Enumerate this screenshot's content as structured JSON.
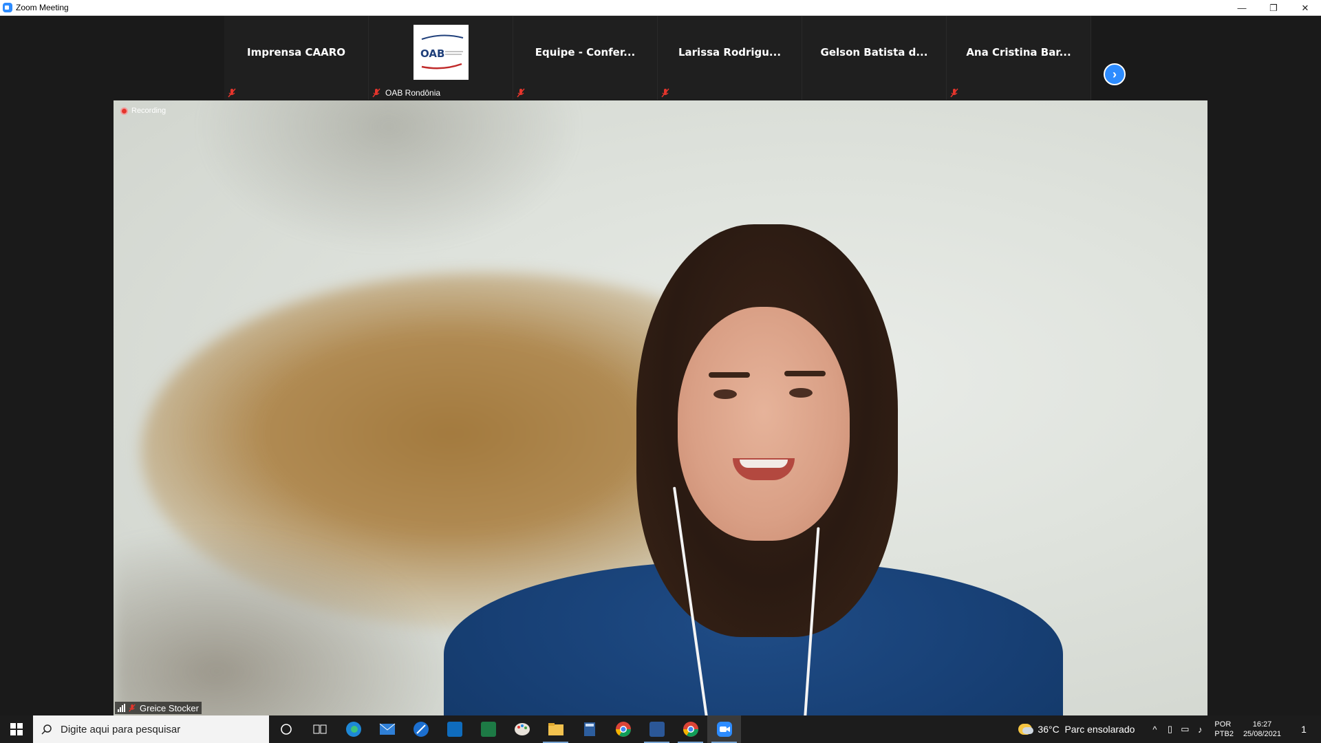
{
  "window": {
    "title": "Zoom Meeting",
    "minimize": "—",
    "restore": "❐",
    "close": "✕"
  },
  "thumbnails": [
    {
      "name": "Imprensa CAARO",
      "muted": true
    },
    {
      "label": "OAB Rondônia",
      "muted": true,
      "has_logo": true,
      "logo_text": "OAB"
    },
    {
      "name": "Equipe - Confer...",
      "muted": true
    },
    {
      "name": "Larissa Rodrigu...",
      "muted": true
    },
    {
      "name": "Gelson Batista d...",
      "muted": false
    },
    {
      "name": "Ana Cristina Bar...",
      "muted": true
    }
  ],
  "next_button": "›",
  "video": {
    "recording_label": "Recording",
    "speaker_name": "Greice Stocker"
  },
  "taskbar": {
    "search_placeholder": "Digite aqui para pesquisar",
    "apps": [
      "cortana-icon",
      "task-view-icon",
      "edge-icon",
      "mail-icon",
      "browser-icon",
      "outlook-icon",
      "excel-icon",
      "paint-icon",
      "file-explorer-icon",
      "calculator-icon",
      "chrome-icon",
      "word-icon",
      "chrome-profile-icon",
      "zoom-icon"
    ],
    "weather_temp": "36°C",
    "weather_desc": "Parc ensolarado",
    "lang_1": "POR",
    "lang_2": "PTB2",
    "time": "16:27",
    "date": "25/08/2021",
    "notif_count": "1"
  },
  "colors": {
    "zoom_blue": "#2D8CFF",
    "mute_red": "#E5352C",
    "recording_red": "#E5352C"
  }
}
